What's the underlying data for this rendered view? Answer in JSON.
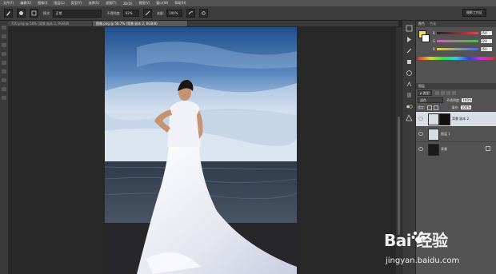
{
  "menu": [
    "文件(F)",
    "编辑(E)",
    "图像(I)",
    "图层(L)",
    "类型(Y)",
    "选择(S)",
    "滤镜(T)",
    "3D(D)",
    "视图(V)",
    "窗口(W)",
    "帮助(H)"
  ],
  "options": {
    "mode_label": "模式:",
    "mode_value": "正常",
    "opacity_label": "不透明度:",
    "opacity_value": "62%",
    "flow_label": "流量:",
    "flow_value": "100%",
    "workspace": "摄影工作区"
  },
  "tabs": [
    {
      "label": "750.png @ 56% (背景 副本 2, RGB/8)"
    },
    {
      "label": "图像.png @ 56.7% (背景 副本 2, RGB/8)"
    }
  ],
  "panels": {
    "color_tab": "颜色",
    "swatches_tab": "色板",
    "channels": [
      {
        "label": "R",
        "value": "250",
        "color": "#e04848"
      },
      {
        "label": "G",
        "value": "220",
        "color": "#48c048"
      },
      {
        "label": "B",
        "value": "150",
        "color": "#4868e0"
      }
    ],
    "layers_tab": "图层",
    "filter_kind": "ρ 类型",
    "blend_mode": "滤色",
    "opacity_label": "不透明度:",
    "opacity_value": "100%",
    "lock_label": "锁定:",
    "fill_label": "填充:",
    "fill_value": "100%",
    "layers": [
      {
        "name": "背景 副本 2",
        "selected": true
      },
      {
        "name": "图层 1",
        "selected": false
      },
      {
        "name": "背景",
        "selected": false
      }
    ]
  },
  "watermark": {
    "brand": "Bai 经验",
    "url": "jingyan.baidu.com"
  }
}
